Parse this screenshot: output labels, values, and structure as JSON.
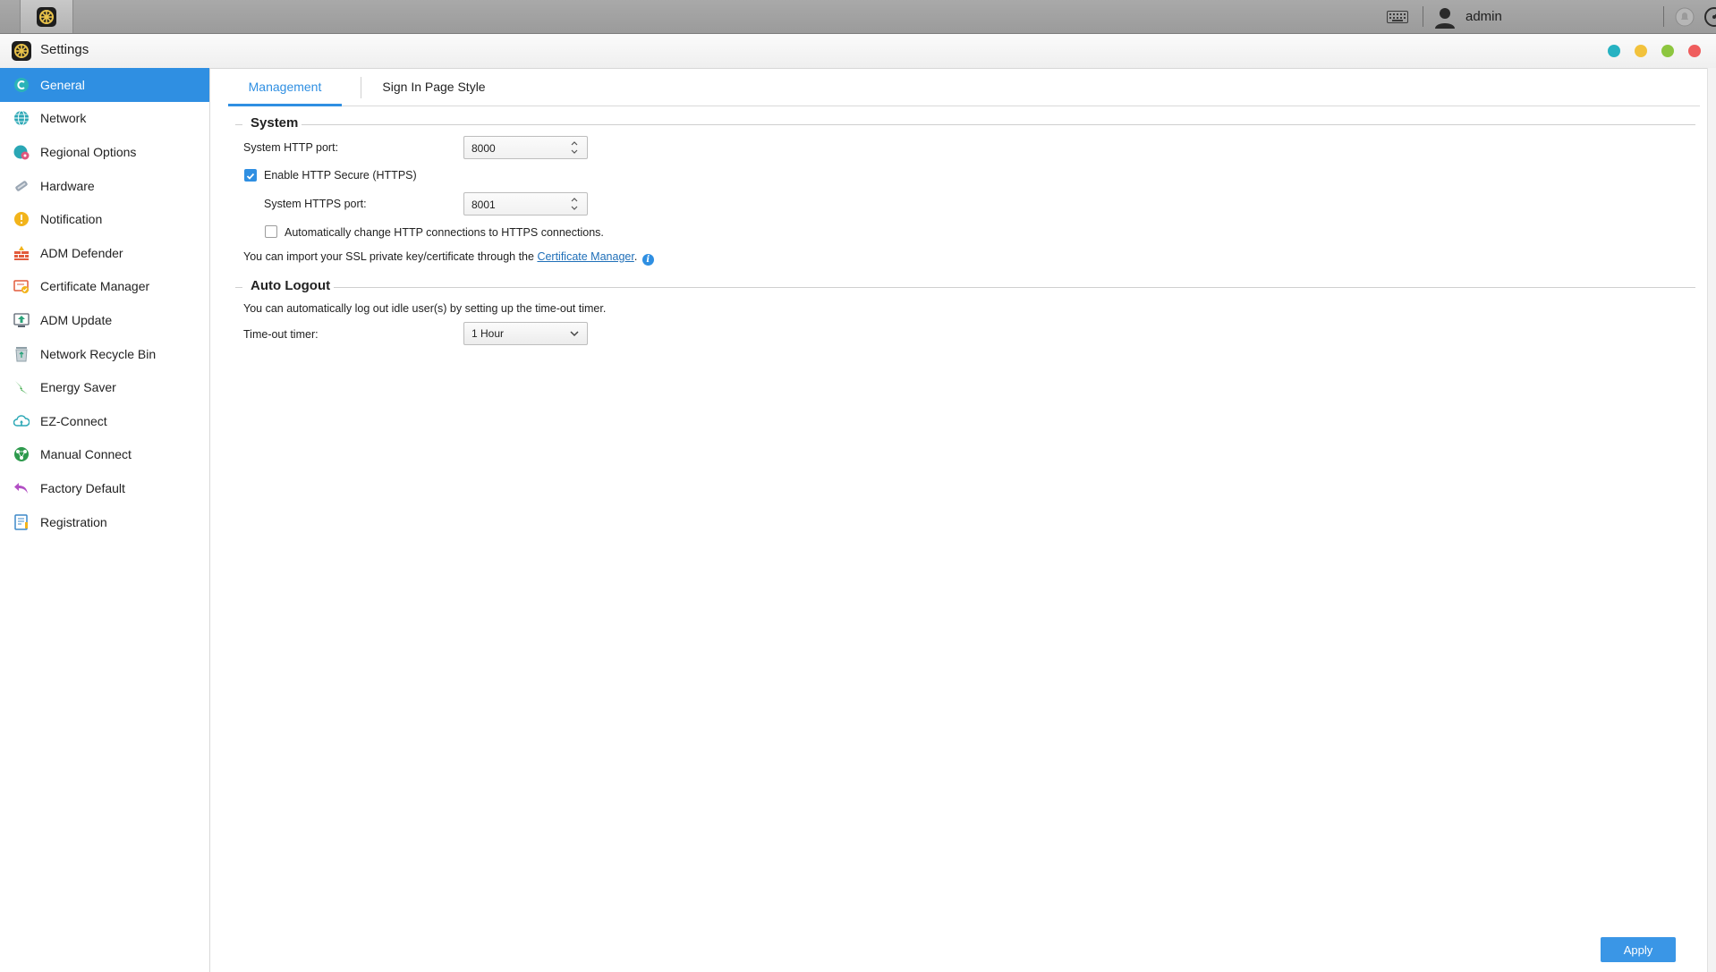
{
  "taskbar": {
    "user_name": "admin",
    "icons": [
      "settings-app-icon",
      "keyboard-icon",
      "user-avatar-icon",
      "notification-icon",
      "performance-gauge-icon",
      "search-icon"
    ]
  },
  "window": {
    "title": "Settings",
    "controls": [
      {
        "name": "window-dot-teal",
        "color": "#26b2c2"
      },
      {
        "name": "window-dot-yellow",
        "color": "#f2c23c"
      },
      {
        "name": "window-dot-green",
        "color": "#8dc63f"
      },
      {
        "name": "window-dot-red",
        "color": "#ef5d5d"
      }
    ]
  },
  "sidebar": {
    "items": [
      {
        "label": "General",
        "icon": "general-icon",
        "active": true
      },
      {
        "label": "Network",
        "icon": "globe-icon"
      },
      {
        "label": "Regional Options",
        "icon": "regional-icon"
      },
      {
        "label": "Hardware",
        "icon": "hardware-icon"
      },
      {
        "label": "Notification",
        "icon": "alert-icon"
      },
      {
        "label": "ADM Defender",
        "icon": "firewall-icon"
      },
      {
        "label": "Certificate Manager",
        "icon": "certificate-icon"
      },
      {
        "label": "ADM Update",
        "icon": "update-icon"
      },
      {
        "label": "Network Recycle Bin",
        "icon": "recycle-bin-icon"
      },
      {
        "label": "Energy Saver",
        "icon": "energy-icon"
      },
      {
        "label": "EZ-Connect",
        "icon": "cloud-icon"
      },
      {
        "label": "Manual Connect",
        "icon": "connect-icon"
      },
      {
        "label": "Factory Default",
        "icon": "undo-icon"
      },
      {
        "label": "Registration",
        "icon": "registration-icon"
      }
    ]
  },
  "tabs": [
    {
      "label": "Management",
      "active": true
    },
    {
      "label": "Sign In Page Style",
      "active": false
    }
  ],
  "system": {
    "heading": "System",
    "http_port_label": "System HTTP port:",
    "http_port_value": "8000",
    "https_enable_label": "Enable HTTP Secure (HTTPS)",
    "https_enabled": true,
    "https_port_label": "System HTTPS port:",
    "https_port_value": "8001",
    "auto_redirect_label": "Automatically change HTTP connections to HTTPS connections.",
    "auto_redirect_checked": false,
    "ssl_text": "You can import your SSL private key/certificate through the",
    "ssl_link": "Certificate Manager",
    "ssl_text_end": "."
  },
  "auto_logout": {
    "heading": "Auto Logout",
    "description": "You can automatically log out idle user(s) by setting up the time-out timer.",
    "timer_label": "Time-out timer:",
    "timer_value": "1 Hour"
  },
  "footer": {
    "apply_label": "Apply"
  },
  "colors": {
    "accent": "#2f8fe2",
    "taskbar": "#a3a3a3"
  }
}
